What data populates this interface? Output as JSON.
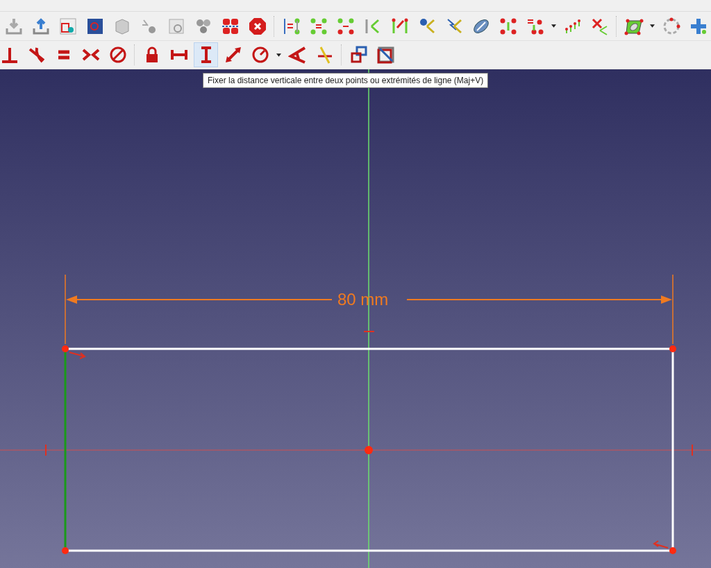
{
  "sketcher_toolbar": {
    "tools": [
      {
        "selected": false
      },
      {
        "selected": false
      },
      {
        "selected": false
      },
      {
        "selected": false
      },
      {
        "selected": false
      },
      {
        "selected": false
      },
      {
        "selected": false
      },
      {
        "selected": true
      },
      {
        "selected": false
      },
      {
        "selected": false
      },
      {
        "selected": false
      },
      {
        "selected": false
      },
      {
        "selected": false
      },
      {
        "selected": false
      }
    ]
  },
  "tooltip": {
    "text": "Fixer la distance verticale entre deux points ou extrémités de ligne (Maj+V)"
  },
  "sketch": {
    "dimension": {
      "label": "80 mm"
    }
  }
}
